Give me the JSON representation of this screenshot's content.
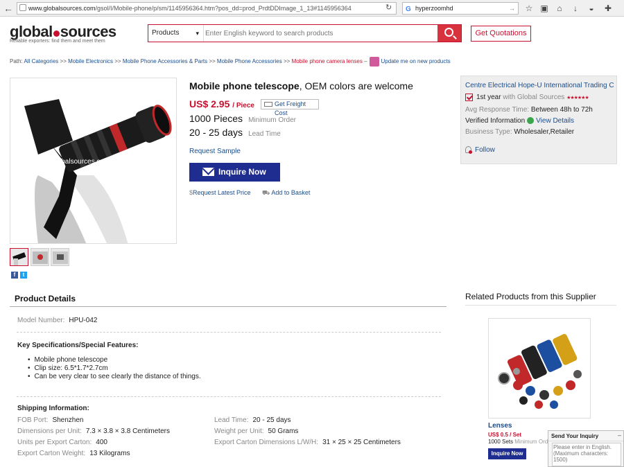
{
  "browser": {
    "url_host": "www.globalsources.com",
    "url_rest": "/gsol/I/Mobile-phone/p/sm/1145956364.htm?pos_dd=prod_PrdtDDImage_1_13#1145956364",
    "search_query": "hyperzoomhd"
  },
  "header": {
    "logo_left": "global",
    "logo_right": "sources",
    "tagline": "Reliable exporters: find them and meet them",
    "search_category": "Products",
    "search_placeholder": "Enter English keyword to search products",
    "quote_button": "Get Quotations"
  },
  "path": {
    "label": "Path:",
    "items": [
      "All Categories",
      "Mobile Electronics",
      "Mobile Phone Accessories & Parts",
      "Mobile Phone Accessories"
    ],
    "sep": ">>",
    "current": "Mobile phone camera lenses",
    "dash": "–",
    "update_link": "Update me on new products"
  },
  "product": {
    "title_bold": "Mobile phone telescope",
    "title_rest": ", OEM colors are welcome",
    "price": "US$ 2.95",
    "price_unit": "/ Piece",
    "freight_label": "Get Freight Cost",
    "moq_value": "1000 Pieces",
    "moq_label": "Minimum Order",
    "lead_value": "20 - 25 days",
    "lead_label": "Lead Time",
    "request_sample": "Request Sample",
    "inquire_now": "Inquire Now",
    "request_price": "Request Latest Price",
    "add_basket": "Add to Basket",
    "watermark": "www.globalsources.com/hope-u.co"
  },
  "supplier": {
    "name": "Centre Electrical Hope-U International Trading C...",
    "year_value": "1st year",
    "year_label": "with Global Sources",
    "stars": "★★★★★★",
    "response_label": "Avg Response Time:",
    "response_value": "Between 48h to 72h",
    "verified_label": "Verified Information",
    "view_details": "View Details",
    "business_label": "Business Type:",
    "business_value": "Wholesaler,Retailer",
    "follow": "Follow"
  },
  "details": {
    "heading": "Product Details",
    "model_label": "Model Number:",
    "model_value": "HPU-042",
    "keyspec_heading": "Key Specifications/Special Features:",
    "bullets": [
      "Mobile phone telescope",
      "Clip size: 6.5*1.7*2.7cm",
      "Can be very clear to see clearly the distance of things."
    ],
    "shipping_heading": "Shipping Information:",
    "fob_label": "FOB Port:",
    "fob_value": "Shenzhen",
    "dim_label": "Dimensions per Unit:",
    "dim_value": "7.3 × 3.8 × 3.8 Centimeters",
    "units_label": "Units per Export Carton:",
    "units_value": "400",
    "carton_weight_label": "Export Carton Weight:",
    "carton_weight_value": "13 Kilograms",
    "lead_label": "Lead Time:",
    "lead_value": "20 - 25 days",
    "weight_label": "Weight per Unit:",
    "weight_value": "50 Grams",
    "carton_dim_label": "Export Carton Dimensions L/W/H:",
    "carton_dim_value": "31 × 25 × 25 Centimeters"
  },
  "related": {
    "heading": "Related Products from this Supplier",
    "name": "Lenses",
    "price": "US$ 0.5 / Set",
    "moq_value": "1000 Sets",
    "moq_label": "Minimum Ord",
    "button": "Inquire Now"
  },
  "send_inquiry": {
    "title": "Send Your Inquiry",
    "minimize": "–",
    "placeholder": "Please enter in English. (Maximum characters: 1500)"
  },
  "colors": {
    "brand_red": "#c8102e",
    "link_blue": "#1a4c8b",
    "button_navy": "#1e2d8f"
  }
}
